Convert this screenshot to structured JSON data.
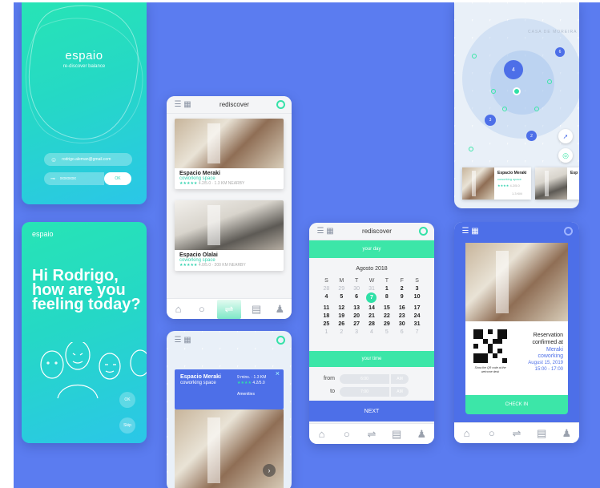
{
  "colors": {
    "background": "#5b7cf0",
    "accent": "#2fe0a6",
    "primary": "#4d6fe8"
  },
  "login": {
    "brand": "espaio",
    "tagline": "re-discover balance",
    "email": "rodrigo.aleman@gmail.com",
    "password": "xxxxxxxx",
    "ok_label": "OK"
  },
  "greeting": {
    "brand": "espaio",
    "message": "Hi Rodrigo, how are you feeling today?",
    "ok_label": "OK",
    "skip_label": "Skip"
  },
  "listing": {
    "title": "rediscover",
    "cards": [
      {
        "name": "Espacio Meraki",
        "type": "coworking space",
        "stars": "★★★★★",
        "rating": "4.2/5.0  ·  1.3 KM NEARBY"
      },
      {
        "name": "Espacio Olalai",
        "type": "coworking space",
        "stars": "★★★★★",
        "rating": "4.0/5.0  ·  200 KM NEARBY"
      }
    ]
  },
  "detail": {
    "name": "Espacio Meraki",
    "type": "coworking space",
    "distance": "9 mins. · 1.3 KM",
    "stars": "★★★★",
    "rating": "4.2/5.0",
    "amenities_label": "Amenities",
    "close_label": "×"
  },
  "calendar": {
    "title": "rediscover",
    "day_band": "your day",
    "month": "Agosto 2018",
    "weekdays": [
      "S",
      "M",
      "T",
      "W",
      "T",
      "F",
      "S"
    ],
    "rows": [
      [
        "28",
        "29",
        "30",
        "31",
        "1",
        "2",
        "3"
      ],
      [
        "4",
        "5",
        "6",
        "7",
        "8",
        "9",
        "10"
      ],
      [
        "11",
        "12",
        "13",
        "14",
        "15",
        "16",
        "17"
      ],
      [
        "18",
        "19",
        "20",
        "21",
        "22",
        "23",
        "24"
      ],
      [
        "25",
        "26",
        "27",
        "28",
        "29",
        "30",
        "31"
      ],
      [
        "1",
        "2",
        "3",
        "4",
        "5",
        "6",
        "7"
      ]
    ],
    "selected": "7",
    "time_band": "your time",
    "from_label": "from",
    "from_time": "6:00",
    "from_ampm": "AM",
    "to_label": "to",
    "to_time": "7:00",
    "to_ampm": "AM",
    "next_label": "NEXT"
  },
  "map": {
    "cluster_big": "4",
    "cluster_a": "6",
    "cluster_b": "3",
    "cluster_c": "2",
    "street_label": "CASA DE MOREIRA",
    "mini_card_name": "Espacio Meraki",
    "mini_card_type": "coworking space",
    "mini_card_stars": "★★★★",
    "mini_card_rating": "4.2/5.0",
    "mini_card_dist": "1.3 KM",
    "mini_card_next": "Esp"
  },
  "reservation": {
    "line1": "Reservation",
    "line2": "confirmed at",
    "place": "Meraki coworking",
    "date": "August 15, 2019",
    "time": "15:00 - 17:00",
    "qr_note": "Show the QR code at the welcome desk",
    "checkin_label": "CHECK IN"
  }
}
